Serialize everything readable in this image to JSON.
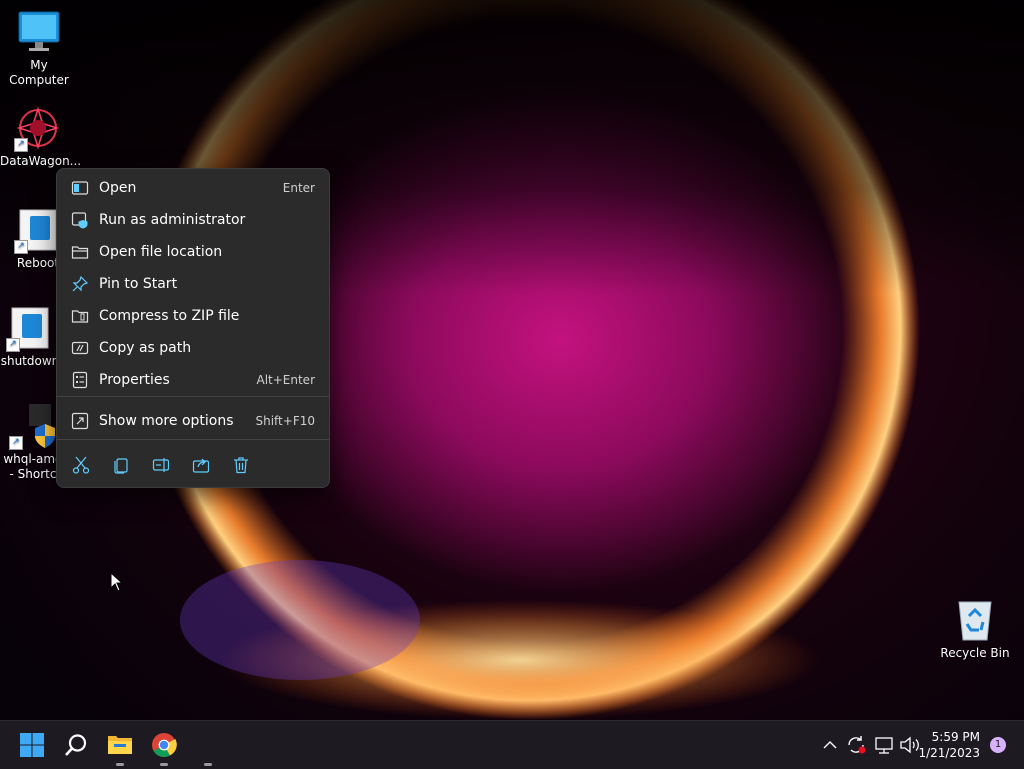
{
  "desktop": {
    "icons": [
      {
        "label": "My Computer",
        "icon": "monitor-icon"
      },
      {
        "label": "DataWagon...",
        "icon": "datawagon-icon"
      },
      {
        "label": "Reboot",
        "icon": "script-icon"
      },
      {
        "label": "shutdown",
        "icon": "script-icon"
      },
      {
        "label": "whql-amd",
        "label2": "- Shortc",
        "icon": "installer-icon"
      },
      {
        "label": "Recycle Bin",
        "icon": "recycle-bin-icon"
      }
    ]
  },
  "context_menu": {
    "items": [
      {
        "label": "Open",
        "shortcut": "Enter",
        "icon": "open-window-icon"
      },
      {
        "label": "Run as administrator",
        "shortcut": "",
        "icon": "shield-icon"
      },
      {
        "label": "Open file location",
        "shortcut": "",
        "icon": "folder-icon"
      },
      {
        "label": "Pin to Start",
        "shortcut": "",
        "icon": "pin-icon"
      },
      {
        "label": "Compress to ZIP file",
        "shortcut": "",
        "icon": "zip-icon"
      },
      {
        "label": "Copy as path",
        "shortcut": "",
        "icon": "path-icon"
      },
      {
        "label": "Properties",
        "shortcut": "Alt+Enter",
        "icon": "properties-icon"
      },
      {
        "label": "Show more options",
        "shortcut": "Shift+F10",
        "icon": "more-options-icon"
      }
    ],
    "actions": [
      "cut-icon",
      "copy-icon",
      "rename-icon",
      "share-icon",
      "delete-icon"
    ]
  },
  "taskbar": {
    "pinned": [
      "start-icon",
      "search-icon",
      "file-explorer-icon",
      "chrome-icon"
    ],
    "tray_icons": [
      "chevron-up-icon",
      "sync-icon",
      "network-icon",
      "volume-icon"
    ],
    "time": "5:59 PM",
    "date": "1/21/2023",
    "notification_count": "1"
  },
  "colors": {
    "menu_bg": "#2b2b2b",
    "accent": "#60cdff",
    "taskbar_bg": "#1e1a22"
  }
}
